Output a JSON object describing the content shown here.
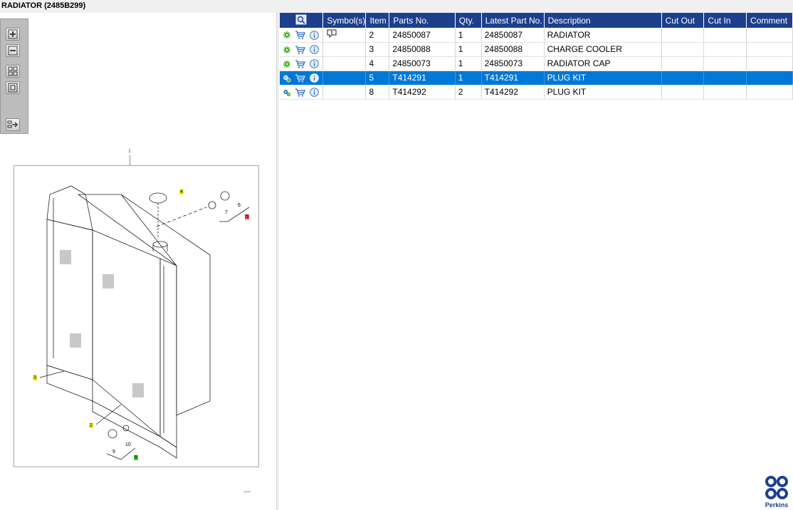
{
  "window": {
    "title": "RADIATOR (2485B299)"
  },
  "toolbox": {
    "zoom_in_icon": "plus-magnifier",
    "zoom_out_icon": "minus-magnifier",
    "fit_icon": "grid-squares",
    "actual_size_icon": "square",
    "export_icon": "export-arrow"
  },
  "drawing": {
    "frame_ref": "1",
    "callouts": [
      {
        "label": "4",
        "color": "#f5ef00"
      },
      {
        "label": "5",
        "color": "#f04c4c"
      },
      {
        "label": "6",
        "color": ""
      },
      {
        "label": "7",
        "color": ""
      },
      {
        "label": "3",
        "color": "#f5ef00"
      },
      {
        "label": "2",
        "color": "#f5ef00"
      },
      {
        "label": "10",
        "color": ""
      },
      {
        "label": "9",
        "color": ""
      },
      {
        "label": "8",
        "color": "#2ddc2d"
      }
    ]
  },
  "grid": {
    "columns": [
      "",
      "Symbol(s)",
      "Item",
      "Parts No.",
      "Qty.",
      "Latest Part No.",
      "Description",
      "Cut Out",
      "Cut In",
      "Comment"
    ],
    "rows": [
      {
        "symbol": "warning",
        "item": "2",
        "part_no": "24850087",
        "qty": "1",
        "latest_part_no": "24850087",
        "description": "RADIATOR",
        "cut_out": "",
        "cut_in": "",
        "comment": "",
        "selected": false
      },
      {
        "symbol": "",
        "item": "3",
        "part_no": "24850088",
        "qty": "1",
        "latest_part_no": "24850088",
        "description": "CHARGE COOLER",
        "cut_out": "",
        "cut_in": "",
        "comment": "",
        "selected": false
      },
      {
        "symbol": "",
        "item": "4",
        "part_no": "24850073",
        "qty": "1",
        "latest_part_no": "24850073",
        "description": "RADIATOR CAP",
        "cut_out": "",
        "cut_in": "",
        "comment": "",
        "selected": false
      },
      {
        "symbol": "",
        "item": "5",
        "part_no": "T414291",
        "qty": "1",
        "latest_part_no": "T414291",
        "description": "PLUG KIT",
        "cut_out": "",
        "cut_in": "",
        "comment": "",
        "selected": true
      },
      {
        "symbol": "",
        "item": "8",
        "part_no": "T414292",
        "qty": "2",
        "latest_part_no": "T414292",
        "description": "PLUG KIT",
        "cut_out": "",
        "cut_in": "",
        "comment": "",
        "selected": false
      }
    ]
  },
  "brand": {
    "name": "Perkins",
    "color": "#1e3f8e"
  },
  "colors": {
    "header_bg": "#1e3f8e",
    "selected_row": "#0078d7",
    "callout_yellow": "#f5ef00"
  }
}
